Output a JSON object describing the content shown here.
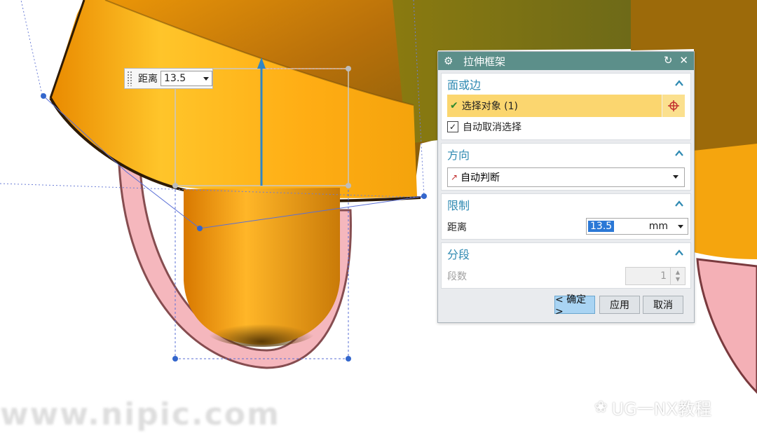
{
  "onscreen_input": {
    "label": "距离",
    "value": "13.5"
  },
  "dialog": {
    "title": "拉伸框架",
    "sections": {
      "face_or_edge": {
        "title": "面或边",
        "select_label": "选择对象 (1)",
        "auto_deselect_label": "自动取消选择",
        "auto_deselect_checked": true
      },
      "direction": {
        "title": "方向",
        "dropdown_value": "自动判断"
      },
      "limit": {
        "title": "限制",
        "distance_label": "距离",
        "distance_value": "13.5",
        "unit": "mm"
      },
      "segment": {
        "title": "分段",
        "count_label": "段数",
        "count_value": "1"
      }
    },
    "buttons": {
      "ok": "< 确定 >",
      "apply": "应用",
      "cancel": "取消"
    }
  },
  "watermarks": {
    "left": "www.nipic.com",
    "right": "UG一NX教程"
  }
}
